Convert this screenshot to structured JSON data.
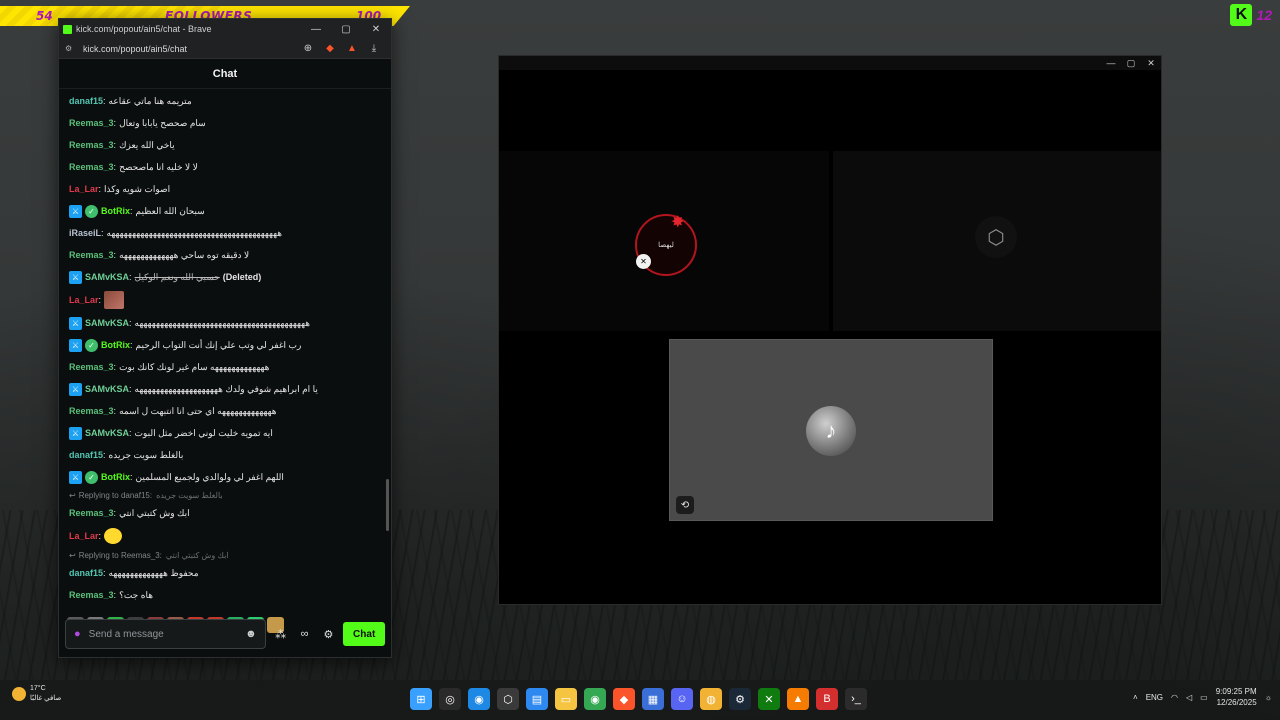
{
  "goal": {
    "current": "54",
    "label": "FOLLOWERS",
    "target": "100",
    "progress": 0.54
  },
  "kick_corner": {
    "logo": "K",
    "number": "12"
  },
  "browser": {
    "title": "kick.com/popout/ain5/chat - Brave",
    "url": "kick.com/popout/ain5/chat",
    "controls": {
      "minimize": "—",
      "maximize": "▢",
      "close": "✕"
    },
    "icons": [
      "site-info-icon",
      "zoom-icon",
      "brave-shields-icon",
      "brave-rewards-icon",
      "download-icon"
    ]
  },
  "chat": {
    "header": "Chat",
    "messages": [
      {
        "user": "danaf15",
        "color": "#52c5b0",
        "badges": [],
        "text": "متريمه هنا ماتي عقاعه"
      },
      {
        "user": "Reemas_3",
        "color": "#5ac07a",
        "badges": [],
        "text": "سام صحصح يابابا وتعال"
      },
      {
        "user": "Reemas_3",
        "color": "#5ac07a",
        "badges": [],
        "text": "ياخي الله يعزك"
      },
      {
        "user": "Reemas_3",
        "color": "#5ac07a",
        "badges": [],
        "text": "لا لا خليه انا ماصحصح"
      },
      {
        "user": "La_Lar",
        "color": "#e0394a",
        "badges": [],
        "text": "اصوات شويه وكذا"
      },
      {
        "user": "BotRix",
        "color": "#53fc18",
        "badges": [
          "mod",
          "verified"
        ],
        "text": "سبحان الله العظيم"
      },
      {
        "user": "iRaseiL",
        "color": "#b7c2d0",
        "badges": [],
        "text": "هههههههههههههههههههههههههههههههههههههههههه"
      },
      {
        "user": "Reemas_3",
        "color": "#5ac07a",
        "badges": [],
        "text": "لا دقيقه توه ساحي هههههههههههههه"
      },
      {
        "user": "SAMvKSA",
        "color": "#6fcf97",
        "badges": [
          "mod"
        ],
        "text": "حسبي الله ونعم الوكيل",
        "deleted": "(Deleted)"
      },
      {
        "user": "La_Lar",
        "color": "#e0394a",
        "badges": [],
        "text": "",
        "emote": "photo"
      },
      {
        "user": "SAMvKSA",
        "color": "#6fcf97",
        "badges": [
          "mod"
        ],
        "text": "هههههههههههههههههههههههههههههههههههههههههه"
      },
      {
        "user": "BotRix",
        "color": "#53fc18",
        "badges": [
          "mod",
          "verified"
        ],
        "text": "رب اغفر لي وتب علي إنك أنت التواب الرحيم"
      },
      {
        "user": "Reemas_3",
        "color": "#5ac07a",
        "badges": [],
        "text": "هههههههههههههه سام غير لونك كانك بوت"
      },
      {
        "user": "SAMvKSA",
        "color": "#6fcf97",
        "badges": [
          "mod"
        ],
        "text": "يا ام ابراهيم شوفي ولدك ههههههههههههههههههههه"
      },
      {
        "user": "Reemas_3",
        "color": "#5ac07a",
        "badges": [],
        "text": "هههههههههههههه اي حتى انا انتبهت ل اسمه"
      },
      {
        "user": "SAMvKSA",
        "color": "#6fcf97",
        "badges": [
          "mod"
        ],
        "text": "ايه تمويه خليت لوني اخضر مثل البوت"
      },
      {
        "user": "danaf15",
        "color": "#52c5b0",
        "badges": [],
        "text": "بالغلط سويت جريده"
      },
      {
        "user": "BotRix",
        "color": "#53fc18",
        "badges": [
          "mod",
          "verified"
        ],
        "text": "اللهم اغفر لي ولوالدي ولجميع المسلمين"
      },
      {
        "reply_to": "Replying to danaf15:",
        "reply_text": "بالغلط سويت جريده",
        "user": "Reemas_3",
        "color": "#5ac07a",
        "badges": [],
        "text": "ابك وش كتبتي انتي"
      },
      {
        "user": "La_Lar",
        "color": "#e0394a",
        "badges": [],
        "text": "",
        "emote": "yellow"
      },
      {
        "reply_to": "Replying to Reemas_3:",
        "reply_text": "ابك وش كتبتي انتي",
        "user": "danaf15",
        "color": "#52c5b0",
        "badges": [],
        "text": "محفوظ هههههههههههههه"
      },
      {
        "user": "Reemas_3",
        "color": "#5ac07a",
        "badges": [],
        "text": "هاه جت؟"
      }
    ],
    "quick_emotes": [
      "#5b5b5b",
      "#7a7a7a",
      "#2fb34a",
      "#3c3c3c",
      "#8a3a3a",
      "#9a5a4a",
      "#c0392b",
      "#c0392b",
      "#27ae60",
      "#2ecc71",
      "#c49a4a"
    ],
    "input_placeholder": "Send a message",
    "send_label": "Chat"
  },
  "call": {
    "controls": {
      "minimize": "—",
      "maximize": "▢",
      "close": "✕"
    },
    "participant1_label": "ليهصا",
    "participant1_muted": true
  },
  "taskbar": {
    "weather_temp": "17°C",
    "weather_desc": "صافي غالبًا",
    "language": "ENG",
    "time": "9:09:25 PM",
    "date": "12/26/2025",
    "apps": [
      "start",
      "search",
      "chrome-alt",
      "obs",
      "notepad",
      "explorer",
      "chrome",
      "brave",
      "store",
      "discord",
      "app-yellow",
      "steam",
      "xbox",
      "app-orange",
      "app-red",
      "terminal"
    ]
  }
}
